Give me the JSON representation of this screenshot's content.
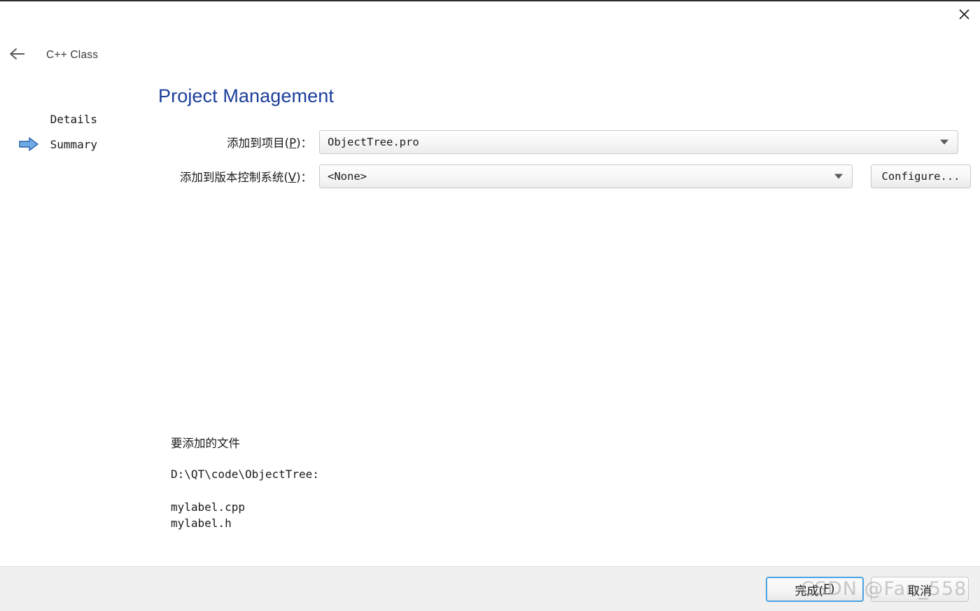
{
  "window": {
    "close_icon": "close-icon",
    "close_label": "×"
  },
  "header": {
    "back_icon": "arrow-left-icon",
    "wizard_kind": "C++ Class"
  },
  "steps": {
    "items": [
      {
        "label": "Details",
        "current": false,
        "icon": ""
      },
      {
        "label": "Summary",
        "current": true,
        "icon": "arrow-right-blue-icon"
      }
    ]
  },
  "page": {
    "title": "Project Management",
    "title_color": "#1d3f9b"
  },
  "form": {
    "project": {
      "label_prefix": "添加到项目(",
      "label_mnemonic": "P",
      "label_suffix": ")：",
      "value": "ObjectTree.pro",
      "caret_icon": "chevron-down-icon"
    },
    "vcs": {
      "label_prefix": "添加到版本控制系统(",
      "label_mnemonic": "V",
      "label_suffix": ")：",
      "value": "<None>",
      "caret_icon": "chevron-down-icon"
    },
    "configure_button": "Configure..."
  },
  "summary": {
    "heading": "要添加的文件",
    "path": "D:\\QT\\code\\ObjectTree:",
    "files": [
      "mylabel.cpp",
      "mylabel.h"
    ]
  },
  "footer": {
    "finish": {
      "prefix": "完成(",
      "mnemonic": "F",
      "suffix": ")"
    },
    "cancel": {
      "label": "取消"
    },
    "accent_color": "#4ba3e3"
  },
  "watermark": {
    "text": "CSDN @Fan_558"
  }
}
